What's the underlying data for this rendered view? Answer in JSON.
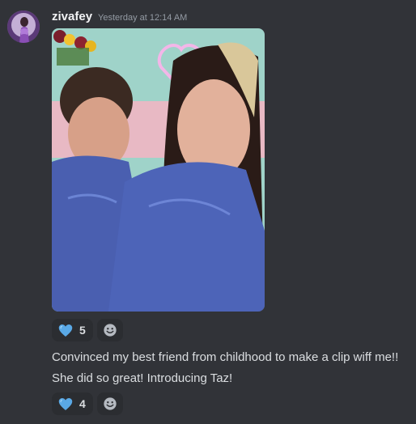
{
  "message": {
    "author": "zivafey",
    "timestamp": "Yesterday at 12:14 AM",
    "avatar_icon": "user-avatar-icon",
    "attachment_icon": "photo-icon"
  },
  "reactions_image": {
    "emoji": "blue-heart-icon",
    "count": "5",
    "add_icon": "add-reaction-smiley-icon"
  },
  "text": {
    "line1": "Convinced my best friend from childhood to make a clip wiff me!!",
    "line2": "She did so great! Introducing Taz!"
  },
  "reactions_text": {
    "emoji": "blue-heart-icon",
    "count": "4",
    "add_icon": "add-reaction-smiley-icon"
  },
  "colors": {
    "background": "#313338",
    "username": "#f2f3f5",
    "timestamp": "#949ba4",
    "text": "#dbdee1",
    "reaction_bg": "#2b2d31",
    "heart": "#5aa9e6"
  }
}
